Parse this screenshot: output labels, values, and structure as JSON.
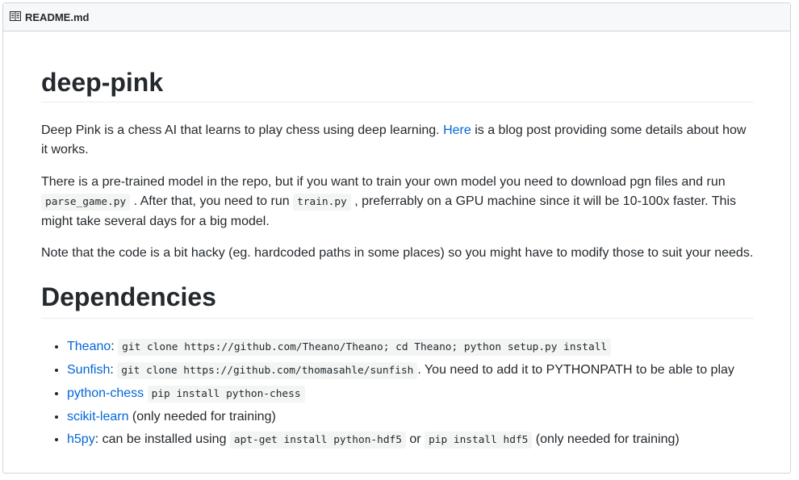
{
  "header": {
    "filename": "README.md",
    "icon": "book-icon"
  },
  "title": "deep-pink",
  "intro": {
    "text_before": "Deep Pink is a chess AI that learns to play chess using deep learning. ",
    "link": "Here",
    "text_after": " is a blog post providing some details about how it works."
  },
  "training": {
    "t1": "There is a pre-trained model in the repo, but if you want to train your own model you need to download pgn files and run",
    "code1": "parse_game.py",
    "t2": ". After that, you need to run",
    "code2": "train.py",
    "t3": ", preferrably on a GPU machine since it will be 10-100x faster. This might take several days for a big model."
  },
  "note": "Note that the code is a bit hacky (eg. hardcoded paths in some places) so you might have to modify those to suit your needs.",
  "deps_title": "Dependencies",
  "deps": [
    {
      "link": "Theano",
      "sep": ": ",
      "code": "git clone https://github.com/Theano/Theano; cd Theano; python setup.py install",
      "after": ""
    },
    {
      "link": "Sunfish",
      "sep": ": ",
      "code": "git clone https://github.com/thomasahle/sunfish",
      "after": ". You need to add it to PYTHONPATH to be able to play"
    },
    {
      "link": "python-chess",
      "sep": " ",
      "code": "pip install python-chess",
      "after": ""
    },
    {
      "link": "scikit-learn",
      "sep": " ",
      "code": "",
      "after": "(only needed for training)"
    },
    {
      "link": "h5py",
      "sep": ": can be installed using ",
      "code": "apt-get install python-hdf5",
      "mid": " or ",
      "code2": "pip install hdf5",
      "after": " (only needed for training)"
    }
  ],
  "colors": {
    "link": "#0366d6",
    "text": "#24292e",
    "border": "#d1d5da"
  }
}
